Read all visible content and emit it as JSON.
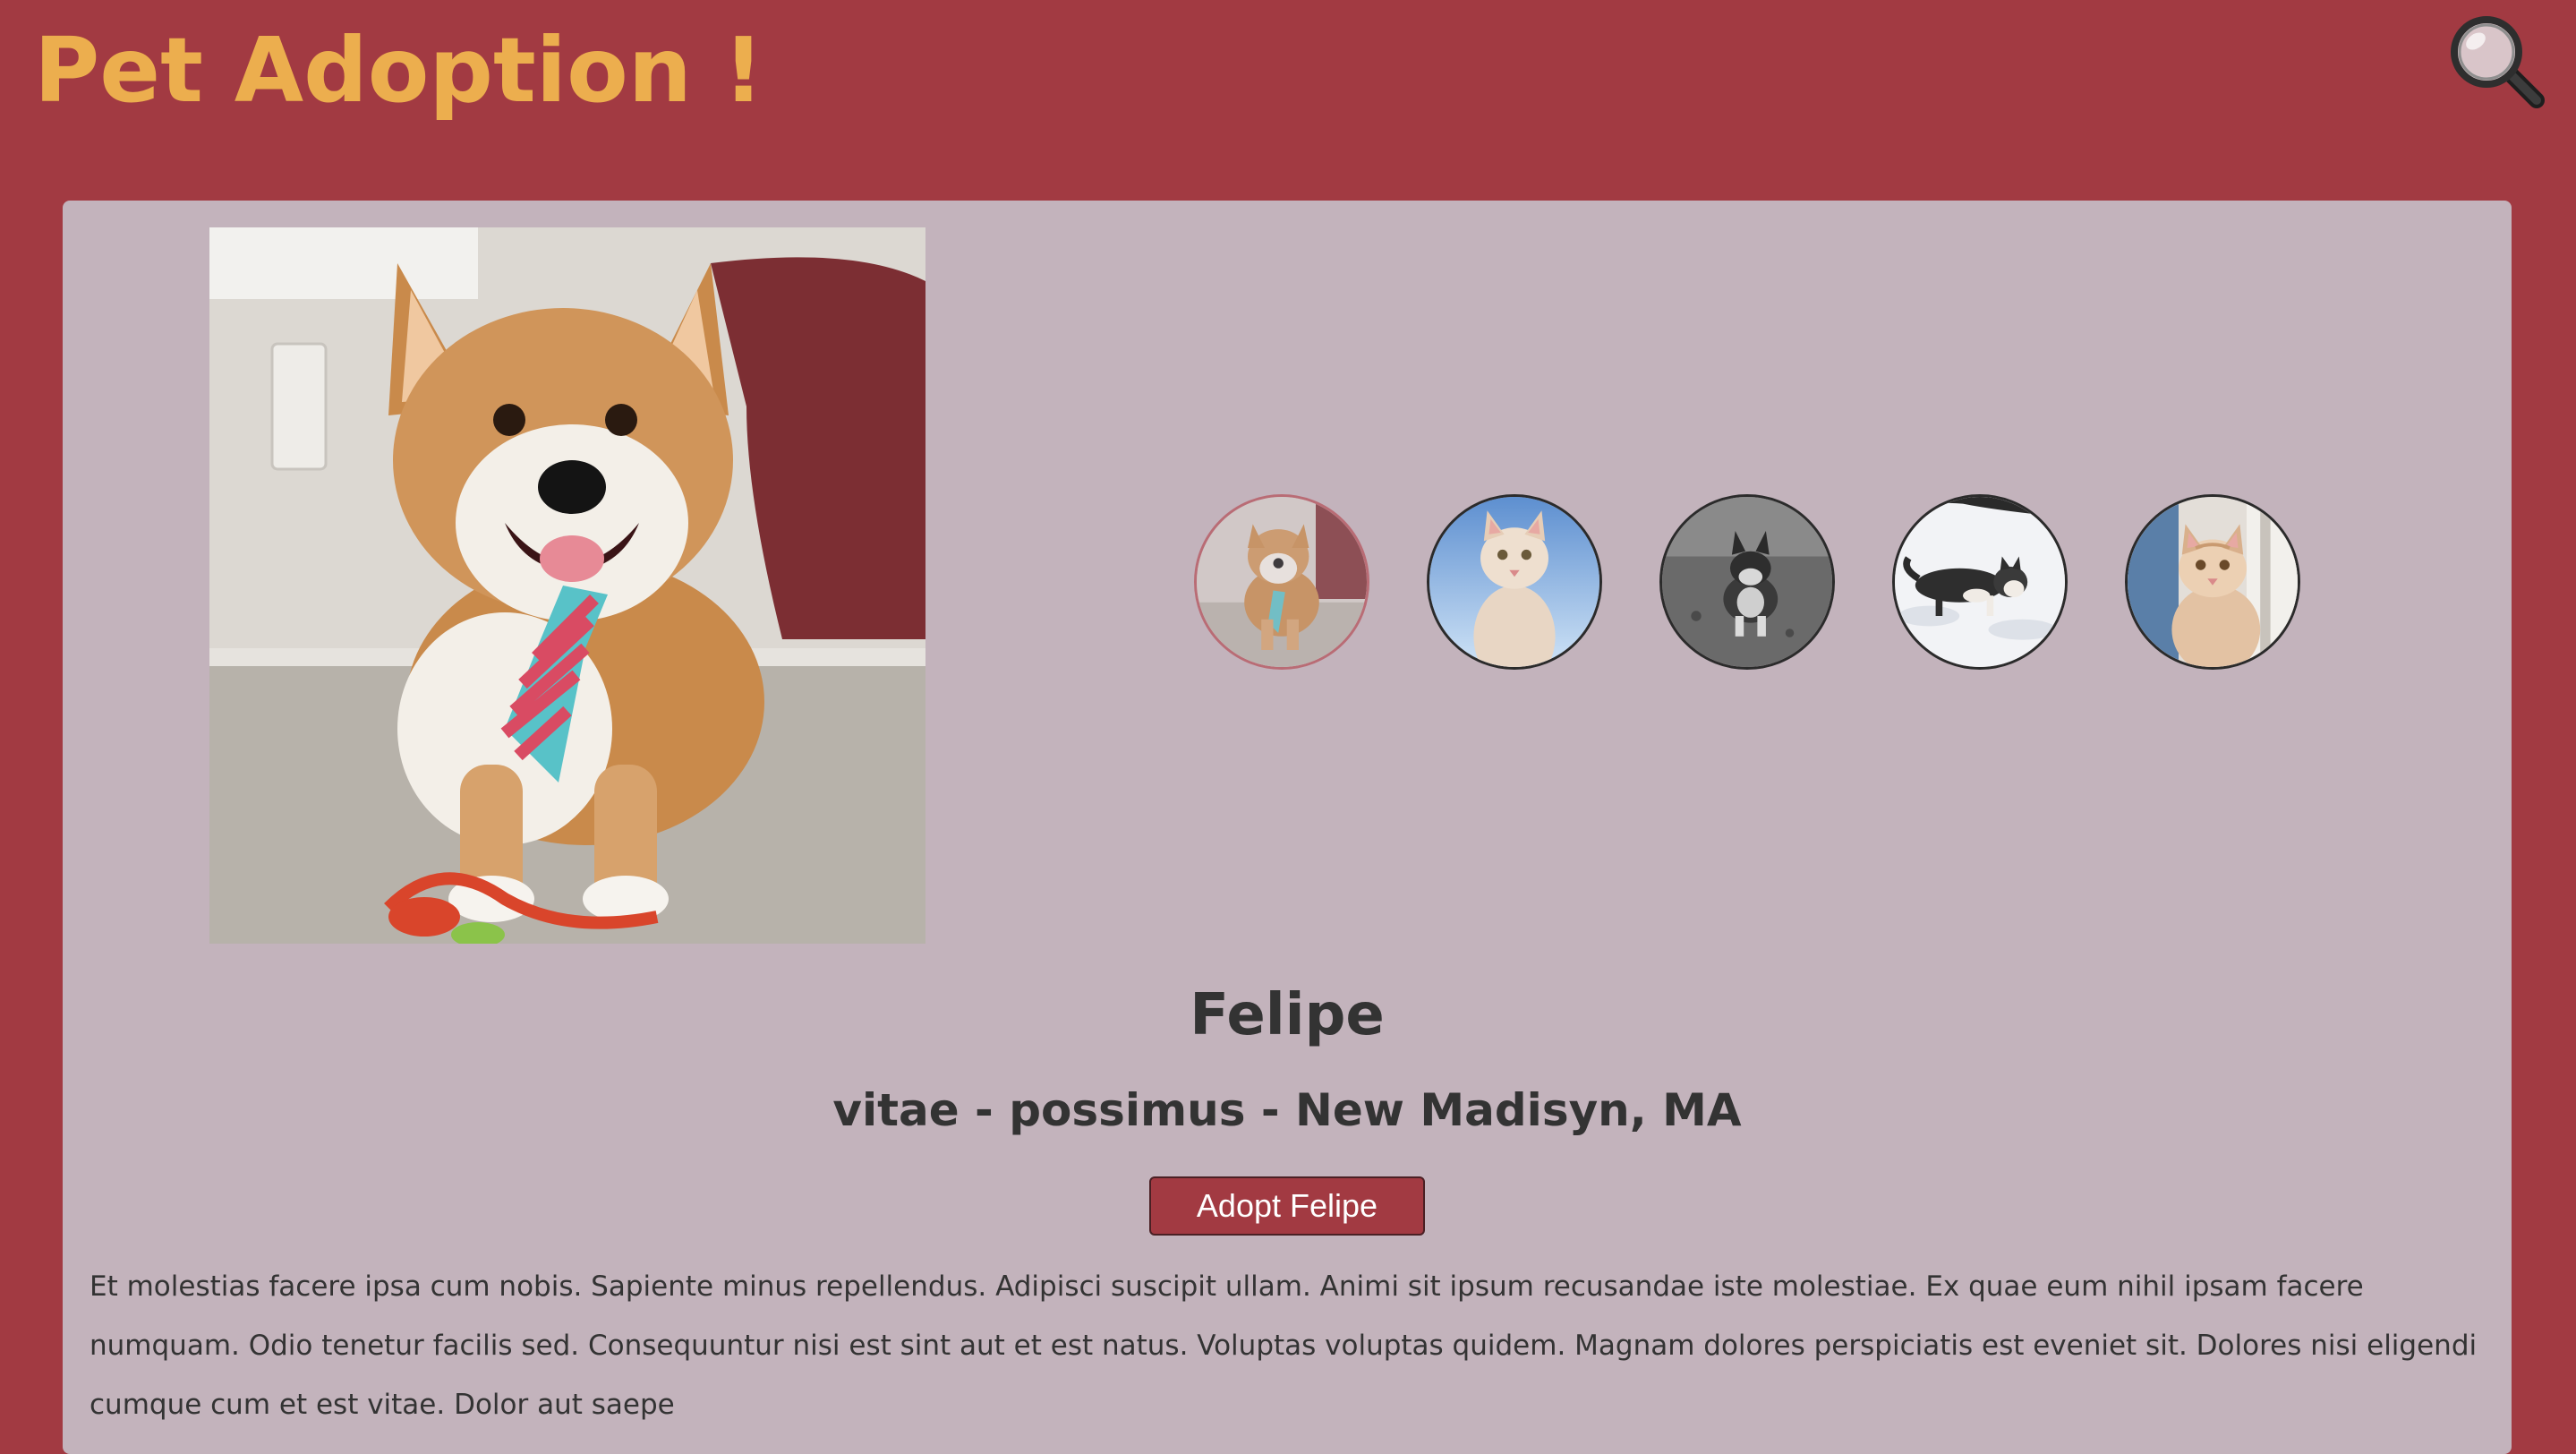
{
  "header": {
    "title": "Pet Adoption !",
    "search_icon": "search-icon"
  },
  "pet": {
    "name": "Felipe",
    "meta": "vitae - possimus - New Madisyn, MA",
    "adopt_label": "Adopt Felipe",
    "description": "Et molestias facere ipsa cum nobis. Sapiente minus repellendus. Adipisci suscipit ullam. Animi sit ipsum recusandae iste molestiae. Ex quae eum nihil ipsam facere numquam. Odio tenetur facilis sed. Consequuntur nisi est sint aut et est natus. Voluptas voluptas quidem. Magnam dolores perspiciatis est eveniet sit. Dolores nisi eligendi cumque cum et est vitae. Dolor aut saepe"
  },
  "gallery": {
    "selected_index": 0,
    "items": [
      "corgi-photo",
      "kitten-photo",
      "dog-grayscale-photo",
      "cat-in-snow-photo",
      "kitten-at-door-photo"
    ]
  },
  "colors": {
    "background": "#a23a42",
    "title": "#ecae4e",
    "card": "#c3b3bc",
    "text": "#333333",
    "button": "#a23a42",
    "selected_border": "#b6555e"
  }
}
